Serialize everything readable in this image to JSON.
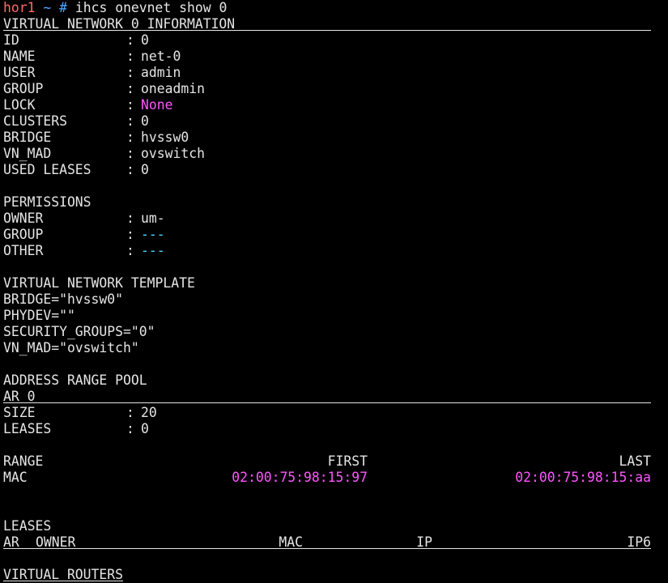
{
  "terminal": {
    "prompt": {
      "host": "hor1",
      "tilde": "~",
      "hash": "#",
      "command": "ihcs onevnet show 0"
    },
    "info_header": "VIRTUAL NETWORK 0 INFORMATION",
    "sep": ":",
    "info": [
      {
        "key": "ID",
        "value": "0"
      },
      {
        "key": "NAME",
        "value": "net-0"
      },
      {
        "key": "USER",
        "value": "admin"
      },
      {
        "key": "GROUP",
        "value": "oneadmin"
      },
      {
        "key": "LOCK",
        "value": "None"
      },
      {
        "key": "CLUSTERS",
        "value": "0"
      },
      {
        "key": "BRIDGE",
        "value": "hvssw0"
      },
      {
        "key": "VN_MAD",
        "value": "ovswitch"
      },
      {
        "key": "USED LEASES",
        "value": "0"
      }
    ],
    "permissions_header": "PERMISSIONS",
    "permissions": [
      {
        "key": "OWNER",
        "value": "um-"
      },
      {
        "key": "GROUP",
        "value": "---"
      },
      {
        "key": "OTHER",
        "value": "---"
      }
    ],
    "template_header": "VIRTUAL NETWORK TEMPLATE",
    "template_lines": [
      "BRIDGE=\"hvssw0\"",
      "PHYDEV=\"\"",
      "SECURITY_GROUPS=\"0\"",
      "VN_MAD=\"ovswitch\""
    ],
    "ar_pool_header": "ADDRESS RANGE POOL",
    "ar_header": "AR 0",
    "ar_info": [
      {
        "key": "SIZE",
        "value": "20"
      },
      {
        "key": "LEASES",
        "value": "0"
      }
    ],
    "range_table": {
      "col_range": "RANGE",
      "col_first": "FIRST",
      "col_last": "LAST",
      "row_label": "MAC",
      "row_first": "02:00:75:98:15:97",
      "row_last": "02:00:75:98:15:aa"
    },
    "leases_header": "LEASES",
    "leases_cols": {
      "ar": "AR",
      "owner": "OWNER",
      "mac": "MAC",
      "ip": "IP",
      "ip6": "IP6"
    },
    "vrouters_header": "VIRTUAL ROUTERS",
    "colors": {
      "background": "#000000",
      "foreground": "#e5e5e5",
      "highlight_magenta": "#ff55ff",
      "highlight_cyan": "#55d7ff",
      "prompt_host": "#ff6b6b",
      "prompt_path": "#4fa8ff"
    }
  }
}
